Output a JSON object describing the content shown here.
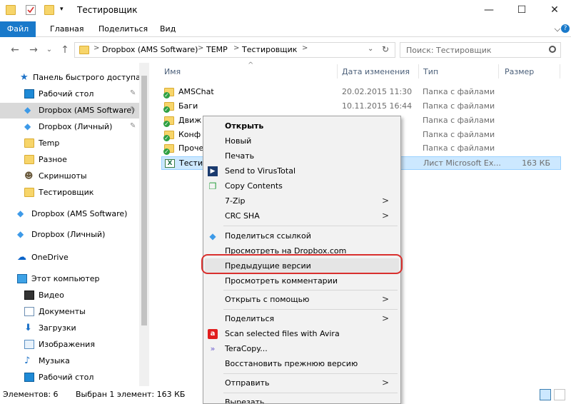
{
  "window": {
    "title": "Тестировщик",
    "minimize": "—",
    "maximize": "☐",
    "close": "✕"
  },
  "ribbon": {
    "tabs": [
      "Файл",
      "Главная",
      "Поделиться",
      "Вид"
    ],
    "help": "?"
  },
  "address": {
    "back": "←",
    "forward": "→",
    "up": "↑",
    "history": "⌄",
    "crumbs": [
      "Dropbox (AMS Software)",
      "TEMP",
      "Тестировщик"
    ],
    "separator": ">",
    "refresh": "↻",
    "search_placeholder": "Поиск: Тестировщик"
  },
  "nav": {
    "pin_glyph": "✎",
    "items": [
      {
        "label": "Панель быстрого доступа",
        "icon": "star-icon"
      },
      {
        "label": "Рабочий стол",
        "icon": "desktop-icon",
        "pinned": true
      },
      {
        "label": "Dropbox (AMS Software)",
        "icon": "dropbox-icon",
        "pinned": true,
        "selected": true
      },
      {
        "label": "Dropbox (Личный)",
        "icon": "dropbox-icon",
        "pinned": true
      },
      {
        "label": "Temp",
        "icon": "folder-icon"
      },
      {
        "label": "Разное",
        "icon": "folder-icon"
      },
      {
        "label": "Скриншоты",
        "icon": "people-folder-icon"
      },
      {
        "label": "Тестировщик",
        "icon": "folder-icon"
      },
      {
        "label": "Dropbox (AMS Software)",
        "icon": "dropbox-icon"
      },
      {
        "label": "Dropbox (Личный)",
        "icon": "dropbox-icon"
      },
      {
        "label": "OneDrive",
        "icon": "onedrive-icon"
      },
      {
        "label": "Этот компьютер",
        "icon": "computer-icon"
      },
      {
        "label": "Видео",
        "icon": "video-icon"
      },
      {
        "label": "Документы",
        "icon": "documents-icon"
      },
      {
        "label": "Загрузки",
        "icon": "downloads-icon"
      },
      {
        "label": "Изображения",
        "icon": "pictures-icon"
      },
      {
        "label": "Музыка",
        "icon": "music-icon"
      },
      {
        "label": "Рабочий стол",
        "icon": "desktop-icon"
      }
    ]
  },
  "columns": {
    "name": "Имя",
    "date": "Дата изменения",
    "type": "Тип",
    "size": "Размер",
    "sort_glyph": "^"
  },
  "files": [
    {
      "name": "AMSChat",
      "date": "20.02.2015 11:30",
      "type": "Папка с файлами",
      "size": ""
    },
    {
      "name": "Баги",
      "date": "10.11.2015 16:44",
      "type": "Папка с файлами",
      "size": ""
    },
    {
      "name": "Движ",
      "date": "",
      "type": "Папка с файлами",
      "size": ""
    },
    {
      "name": "Конф",
      "date": "",
      "type": "Папка с файлами",
      "size": ""
    },
    {
      "name": "Проче",
      "date": "",
      "type": "Папка с файлами",
      "size": ""
    },
    {
      "name": "Тестир",
      "date": "",
      "type": "Лист Microsoft Ex...",
      "size": "163 КБ"
    }
  ],
  "status": {
    "items_count": "Элементов: 6",
    "selected": "Выбран 1 элемент: 163 КБ"
  },
  "context_menu": {
    "submenu_arrow": ">",
    "items": [
      {
        "label": "Открыть",
        "bold": true
      },
      {
        "label": "Новый"
      },
      {
        "label": "Печать"
      },
      {
        "label": "Send to VirusTotal",
        "icon": "virustotal-icon"
      },
      {
        "label": "Copy Contents",
        "icon": "copy-contents-icon"
      },
      {
        "label": "7-Zip",
        "submenu": true
      },
      {
        "label": "CRC SHA",
        "submenu": true
      },
      {
        "label": "Поделиться ссылкой",
        "icon": "dropbox-icon"
      },
      {
        "label": "Просмотреть на Dropbox.com"
      },
      {
        "label": "Предыдущие версии",
        "highlighted": true
      },
      {
        "label": "Просмотреть комментарии"
      },
      {
        "label": "Открыть с помощью",
        "submenu": true
      },
      {
        "label": "Поделиться",
        "submenu": true
      },
      {
        "label": "Scan selected files with Avira",
        "icon": "avira-icon"
      },
      {
        "label": "TeraCopy...",
        "icon": "teracopy-icon"
      },
      {
        "label": "Восстановить прежнюю версию"
      },
      {
        "label": "Отправить",
        "submenu": true
      },
      {
        "label": "Вырезать"
      }
    ]
  },
  "colors": {
    "accent": "#1979ca",
    "selection": "#cce8ff",
    "highlight_ring": "#d9302e",
    "folder": "#f7d56a",
    "dropbox": "#3d9ae8"
  }
}
